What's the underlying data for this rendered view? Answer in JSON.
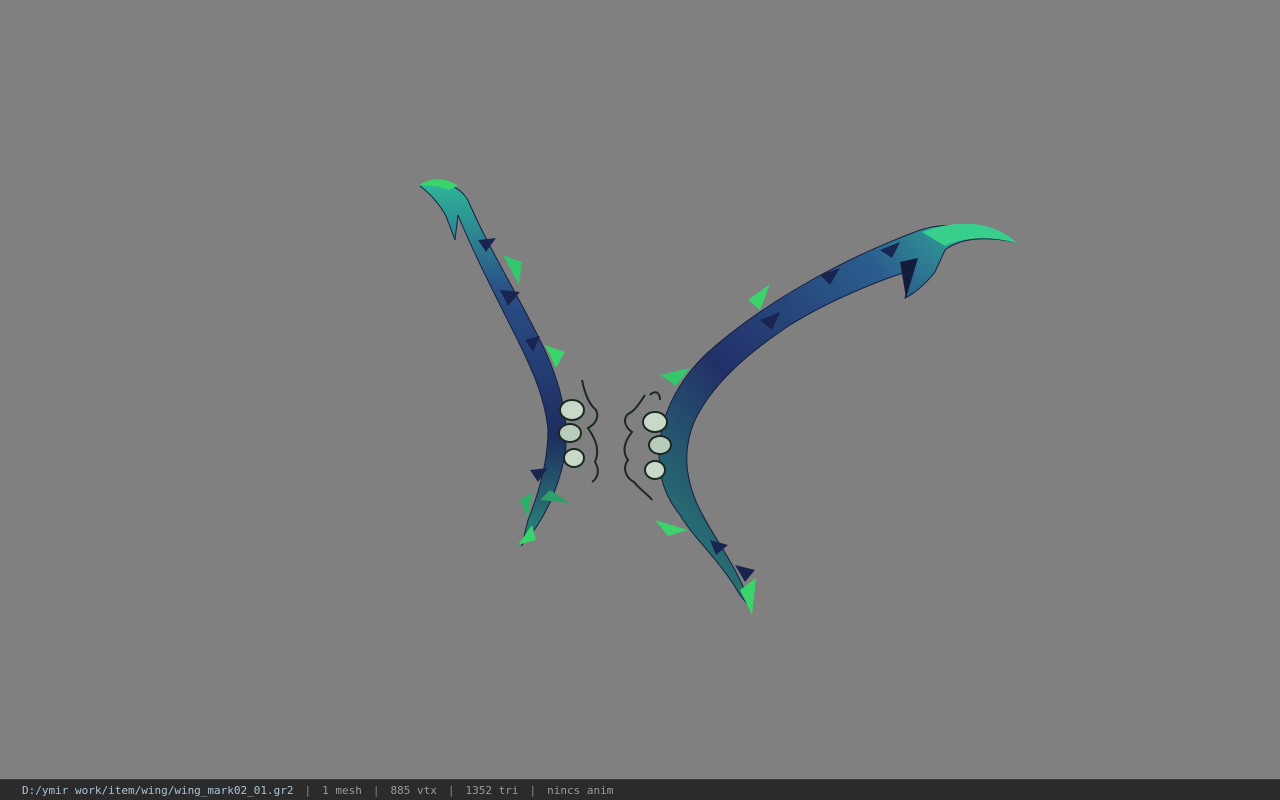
{
  "status_bar": {
    "file_path": "D:/ymir work/item/wing/wing_mark02_01.gr2",
    "separator": "|",
    "mesh_count": "1 mesh",
    "vertex_count": "885 vtx",
    "triangle_count": "1352 tri",
    "anim_status": "nincs anim"
  },
  "colors": {
    "viewport_bg": "#808080",
    "wing_dark": "#1f2a57",
    "wing_mid": "#2e5d8a",
    "wing_teal": "#2aa88a",
    "wing_green": "#3ad46b",
    "ornament_light": "#c9d9c9",
    "ornament_dark": "#1a2a22"
  }
}
